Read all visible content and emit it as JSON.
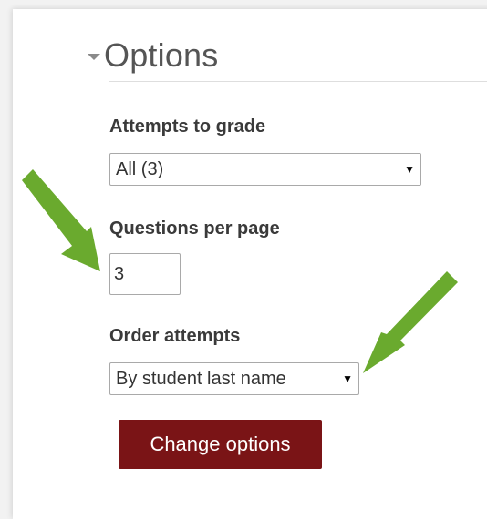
{
  "options": {
    "legend_title": "Options",
    "attempts_label": "Attempts to grade",
    "attempts_value": "All (3)",
    "questions_label": "Questions per page",
    "questions_value": "3",
    "order_label": "Order attempts",
    "order_value": "By student last name",
    "change_button": "Change options"
  },
  "icons": {
    "legend_toggle": "caret-down-icon",
    "dropdown": "dropdown-triangle-icon",
    "annotation": "green-arrow-icon"
  },
  "colors": {
    "button": "#7a1416",
    "annotation_arrow": "#6aaa2e"
  }
}
